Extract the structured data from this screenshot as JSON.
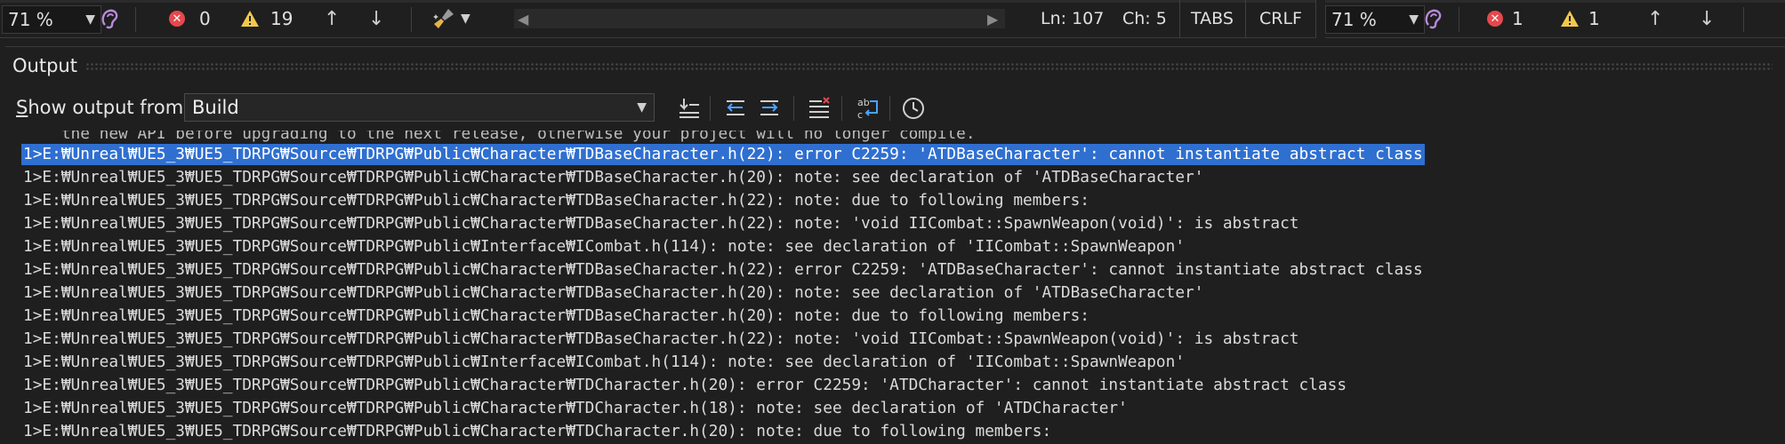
{
  "left_bar": {
    "zoom": "71 %",
    "errors": "0",
    "warnings": "19",
    "position": {
      "line": "Ln: 107",
      "col": "Ch: 5"
    },
    "indent": "TABS",
    "line_ending": "CRLF"
  },
  "right_bar": {
    "zoom": "71 %",
    "errors": "1",
    "warnings": "1"
  },
  "output_panel": {
    "title": "Output",
    "show_from_prefix": "S",
    "show_from_rest": "how output from:",
    "source": "Build"
  },
  "log": {
    "partial_top": "    the new API before upgrading to the next release, otherwise your project will no longer compile.",
    "lines": [
      "1>E:₩Unreal₩UE5_3₩UE5_TDRPG₩Source₩TDRPG₩Public₩Character₩TDBaseCharacter.h(22): error C2259: 'ATDBaseCharacter': cannot instantiate abstract class",
      "1>E:₩Unreal₩UE5_3₩UE5_TDRPG₩Source₩TDRPG₩Public₩Character₩TDBaseCharacter.h(20): note: see declaration of 'ATDBaseCharacter'",
      "1>E:₩Unreal₩UE5_3₩UE5_TDRPG₩Source₩TDRPG₩Public₩Character₩TDBaseCharacter.h(22): note: due to following members:",
      "1>E:₩Unreal₩UE5_3₩UE5_TDRPG₩Source₩TDRPG₩Public₩Character₩TDBaseCharacter.h(22): note: 'void IICombat::SpawnWeapon(void)': is abstract",
      "1>E:₩Unreal₩UE5_3₩UE5_TDRPG₩Source₩TDRPG₩Public₩Interface₩ICombat.h(114): note: see declaration of 'IICombat::SpawnWeapon'",
      "1>E:₩Unreal₩UE5_3₩UE5_TDRPG₩Source₩TDRPG₩Public₩Character₩TDBaseCharacter.h(22): error C2259: 'ATDBaseCharacter': cannot instantiate abstract class",
      "1>E:₩Unreal₩UE5_3₩UE5_TDRPG₩Source₩TDRPG₩Public₩Character₩TDBaseCharacter.h(20): note: see declaration of 'ATDBaseCharacter'",
      "1>E:₩Unreal₩UE5_3₩UE5_TDRPG₩Source₩TDRPG₩Public₩Character₩TDBaseCharacter.h(20): note: due to following members:",
      "1>E:₩Unreal₩UE5_3₩UE5_TDRPG₩Source₩TDRPG₩Public₩Character₩TDBaseCharacter.h(22): note: 'void IICombat::SpawnWeapon(void)': is abstract",
      "1>E:₩Unreal₩UE5_3₩UE5_TDRPG₩Source₩TDRPG₩Public₩Interface₩ICombat.h(114): note: see declaration of 'IICombat::SpawnWeapon'",
      "1>E:₩Unreal₩UE5_3₩UE5_TDRPG₩Source₩TDRPG₩Public₩Character₩TDCharacter.h(20): error C2259: 'ATDCharacter': cannot instantiate abstract class",
      "1>E:₩Unreal₩UE5_3₩UE5_TDRPG₩Source₩TDRPG₩Public₩Character₩TDCharacter.h(18): note: see declaration of 'ATDCharacter'",
      "1>E:₩Unreal₩UE5_3₩UE5_TDRPG₩Source₩TDRPG₩Public₩Character₩TDCharacter.h(20): note: due to following members:"
    ]
  },
  "colors": {
    "selection": "#2f6fd0",
    "error": "#e5484d",
    "warning": "#f2c94c",
    "background": "#1f1f1f"
  },
  "icons": [
    "zoom-chevron-icon",
    "telemetry-ear-icon",
    "error-icon",
    "warning-icon",
    "arrow-up-icon",
    "arrow-down-icon",
    "cleanup-brush-icon",
    "goto-build-error-icon",
    "find-previous-message-icon",
    "find-next-message-icon",
    "clear-all-icon",
    "word-wrap-icon",
    "timestamp-clock-icon"
  ]
}
